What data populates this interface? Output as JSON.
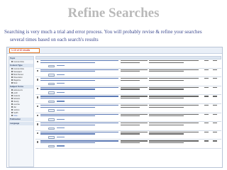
{
  "slide": {
    "title": "Refine Searches",
    "caption_line1": "Searching is very much a trial and error process.  You will probably revise & refine your searches",
    "caption_line2": "several times based on each search's results"
  },
  "screenshot": {
    "results_box": "1-10 of 10 results",
    "sidebar": {
      "facets": [
        {
          "head": "Topic",
          "options": [
            "Journal Article"
          ]
        },
        {
          "head": "Content Type",
          "options": [
            "Journal Article",
            "Newspaper",
            "Book Review",
            "Dissertation",
            "Magazine",
            "Book"
          ]
        },
        {
          "head": "Subject Terms",
          "options": [
            "adolescents",
            "youth",
            "students",
            "behavior",
            "obesity",
            "exercise",
            "diet",
            "nutrition",
            "health",
            "more..."
          ]
        },
        {
          "head": "Publication",
          "options": []
        },
        {
          "head": "Language",
          "options": []
        }
      ]
    },
    "rows": [
      1,
      2,
      3,
      4,
      5,
      6,
      7,
      8,
      9,
      10
    ]
  }
}
